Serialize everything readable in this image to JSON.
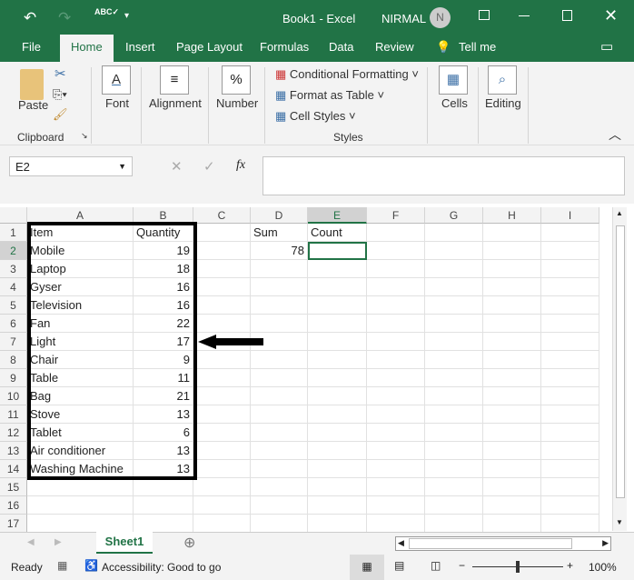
{
  "window": {
    "title": "Book1 - Excel",
    "user": "NIRMAL",
    "avatar_initial": "N"
  },
  "qat": {
    "undo": "↶",
    "redo": "↷",
    "spell": "ABC✓",
    "customize": "▾"
  },
  "tabs": [
    {
      "label": "File"
    },
    {
      "label": "Home"
    },
    {
      "label": "Insert"
    },
    {
      "label": "Page Layout"
    },
    {
      "label": "Formulas"
    },
    {
      "label": "Data"
    },
    {
      "label": "Review"
    },
    {
      "label": "Tell me"
    }
  ],
  "ribbon": {
    "paste": "Paste",
    "clipboard": "Clipboard",
    "font": "Font",
    "alignment": "Alignment",
    "number": "Number",
    "cond_format": "Conditional Formatting",
    "format_table": "Format as Table",
    "cell_styles": "Cell Styles",
    "styles": "Styles",
    "cells": "Cells",
    "editing": "Editing"
  },
  "formula_bar": {
    "name_box": "E2",
    "fx": "fx",
    "value": ""
  },
  "columns": [
    "A",
    "B",
    "C",
    "D",
    "E",
    "F",
    "G",
    "H",
    "I"
  ],
  "rows": [
    [
      "Item",
      "Quantity",
      "",
      "Sum",
      "Count"
    ],
    [
      "Mobile",
      "19",
      "",
      "78",
      ""
    ],
    [
      "Laptop",
      "18"
    ],
    [
      "Gyser",
      "16"
    ],
    [
      "Television",
      "16"
    ],
    [
      "Fan",
      "22"
    ],
    [
      "Light",
      "17"
    ],
    [
      "Chair",
      "9"
    ],
    [
      "Table",
      "11"
    ],
    [
      "Bag",
      "21"
    ],
    [
      "Stove",
      "13"
    ],
    [
      "Tablet",
      "6"
    ],
    [
      "Air conditioner",
      "13"
    ],
    [
      "Washing Machine",
      "13"
    ],
    [],
    [],
    []
  ],
  "selected_cell": "E2",
  "sheet_tabs": [
    {
      "label": "Sheet1"
    }
  ],
  "status": {
    "ready": "Ready",
    "accessibility": "Accessibility: Good to go",
    "zoom": "100%"
  },
  "colors": {
    "accent": "#217346"
  }
}
